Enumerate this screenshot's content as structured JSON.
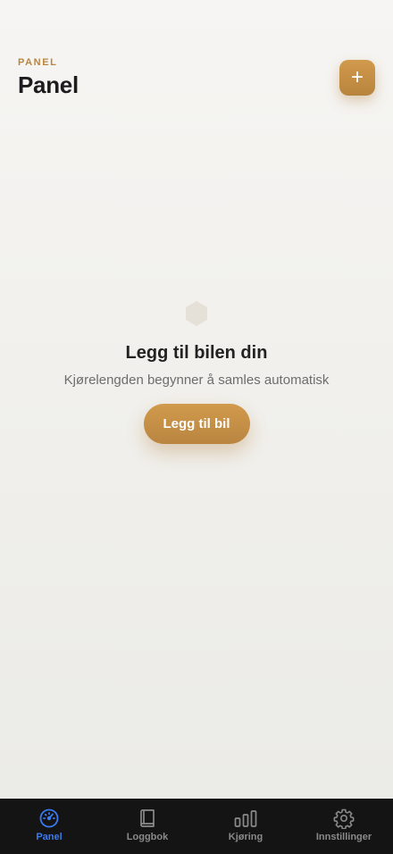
{
  "header": {
    "eyebrow": "PANEL",
    "title": "Panel"
  },
  "add_button": {
    "icon": "plus-icon",
    "label": "+"
  },
  "empty_state": {
    "icon": "hexagon-icon",
    "title": "Legg til bilen din",
    "subtitle": "Kjørelengden begynner å samles automatisk",
    "cta_label": "Legg til bil"
  },
  "tabbar": {
    "tabs": [
      {
        "label": "Panel",
        "icon": "speedometer-icon",
        "active": true
      },
      {
        "label": "Loggbok",
        "icon": "book-icon",
        "active": false
      },
      {
        "label": "Kjøring",
        "icon": "bar-chart-icon",
        "active": false
      },
      {
        "label": "Innstillinger",
        "icon": "gear-icon",
        "active": false
      }
    ]
  },
  "colors": {
    "accent": "#C8914A",
    "active_tab": "#3A7BF0",
    "tabbar_bg": "#141414"
  }
}
